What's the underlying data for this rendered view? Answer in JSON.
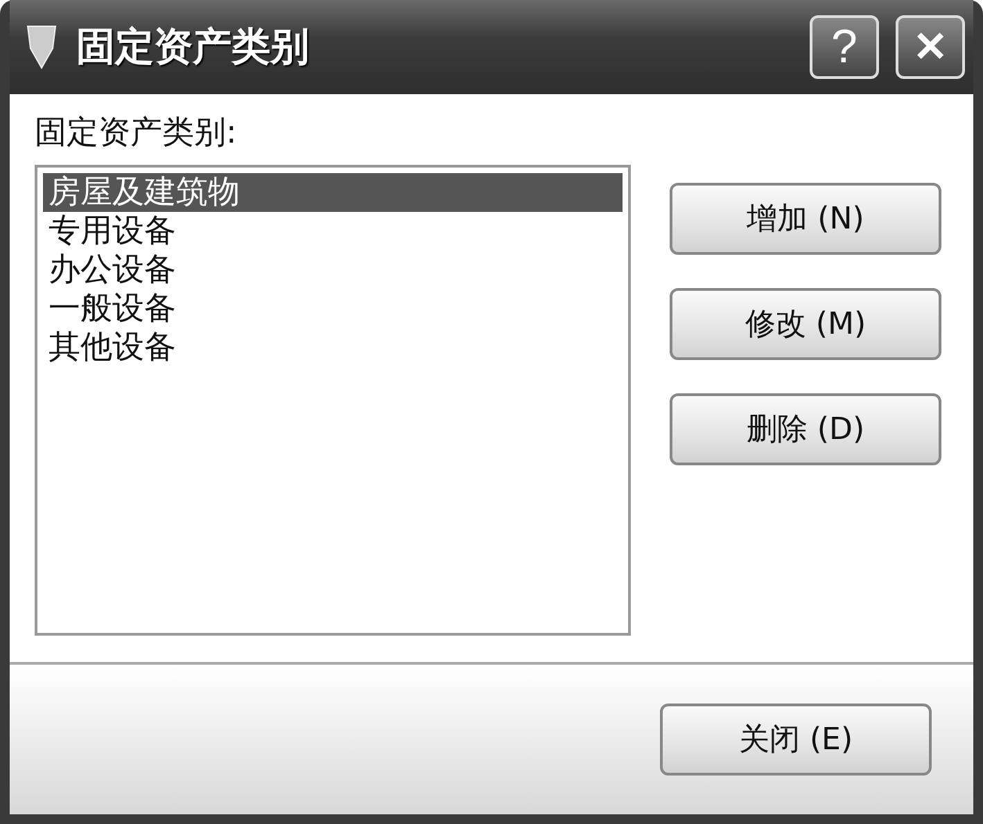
{
  "window": {
    "title": "固定资产类别"
  },
  "title_buttons": [
    {
      "kind": "help",
      "label": "?"
    },
    {
      "kind": "close",
      "label": "✕"
    }
  ],
  "list_label": "固定资产类别:",
  "list_items": [
    {
      "label": "房屋及建筑物",
      "selected": true
    },
    {
      "label": "专用设备",
      "selected": false
    },
    {
      "label": "办公设备",
      "selected": false
    },
    {
      "label": "一般设备",
      "selected": false
    },
    {
      "label": "其他设备",
      "selected": false
    }
  ],
  "side_buttons": [
    {
      "label": "增加 (N)"
    },
    {
      "label": "修改 (M)"
    },
    {
      "label": "删除 (D)"
    }
  ],
  "footer_buttons": [
    {
      "label": "关闭 (E)"
    }
  ]
}
